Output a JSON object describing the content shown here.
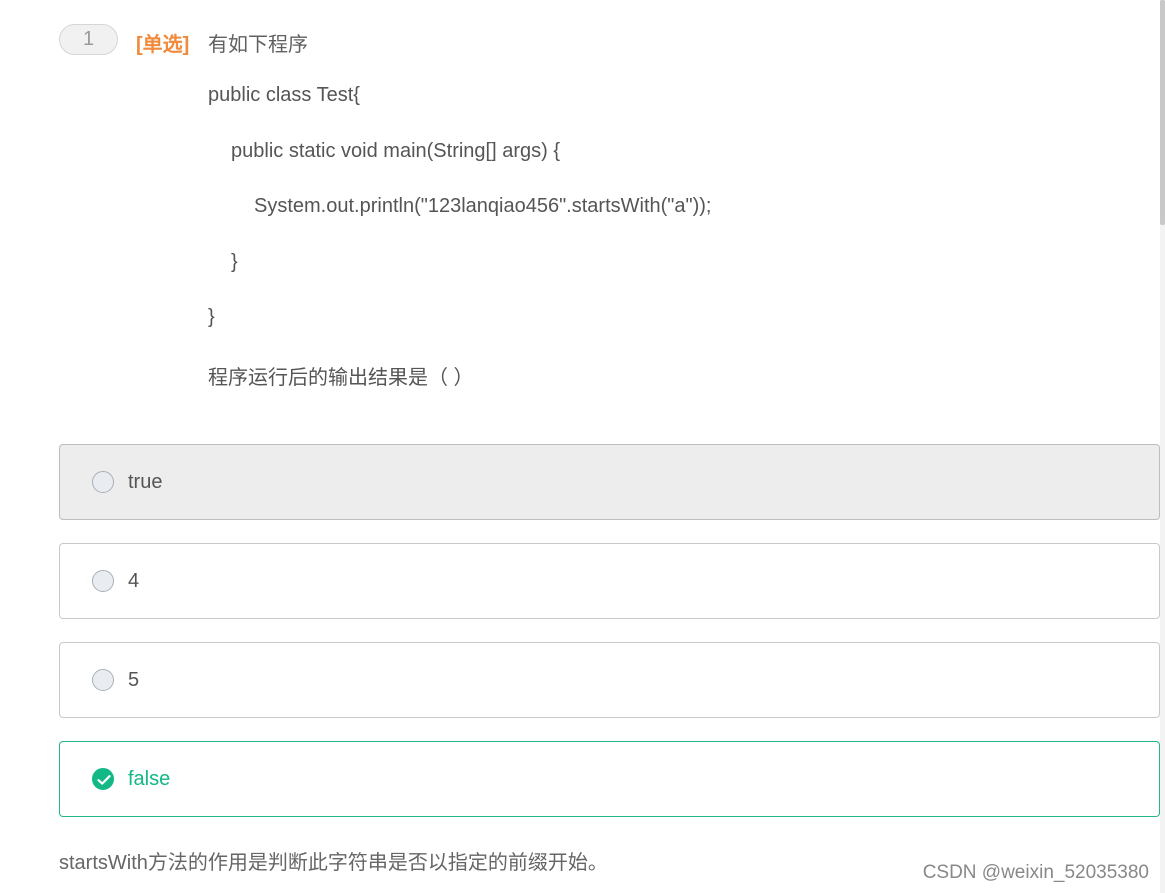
{
  "question": {
    "number": "1",
    "type_label": "[单选]",
    "title": "有如下程序",
    "code_lines": [
      "public class Test{",
      "public static void main(String[] args) {",
      "System.out.println(\"123lanqiao456\".startsWith(\"a\"));",
      "}",
      "}"
    ],
    "prompt": "程序运行后的输出结果是（ ）"
  },
  "options": [
    {
      "label": "true",
      "state": "hover"
    },
    {
      "label": "4",
      "state": "default"
    },
    {
      "label": "5",
      "state": "default"
    },
    {
      "label": "false",
      "state": "correct"
    }
  ],
  "explanation": "startsWith方法的作用是判断此字符串是否以指定的前缀开始。",
  "watermark": "CSDN @weixin_52035380",
  "colors": {
    "accent_orange": "#f08a3c",
    "correct_green": "#12b886"
  }
}
